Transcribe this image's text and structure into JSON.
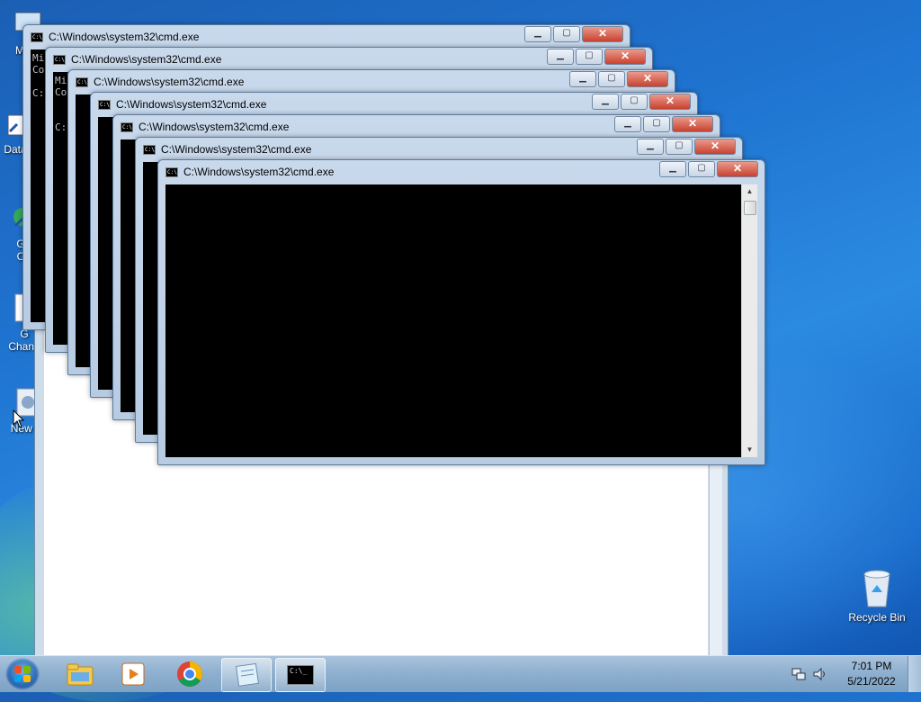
{
  "desktop": {
    "icons": [
      {
        "label": "My C",
        "icon": "computer-icon"
      },
      {
        "label": "Data",
        "icon": "shortcut-icon"
      },
      {
        "label": "G",
        "label2": "C",
        "icon": "shortcut-icon"
      },
      {
        "label": "G",
        "label2": "Chang",
        "icon": "document-icon"
      },
      {
        "label": "New T",
        "icon": "settings-icon"
      },
      {
        "label": "Recycle Bin",
        "icon": "recycle-bin-icon"
      }
    ]
  },
  "windows": [
    {
      "title": "C:\\Windows\\system32\\cmd.exe",
      "text": "Mi\nCo\n\nC:"
    },
    {
      "title": "C:\\Windows\\system32\\cmd.exe",
      "text": "Mi\nCo\n\n\nC:"
    },
    {
      "title": "C:\\Windows\\system32\\cmd.exe",
      "text": ""
    },
    {
      "title": "C:\\Windows\\system32\\cmd.exe",
      "text": ""
    },
    {
      "title": "C:\\Windows\\system32\\cmd.exe",
      "text": ""
    },
    {
      "title": "C:\\Windows\\system32\\cmd.exe",
      "text": ""
    },
    {
      "title": "C:\\Windows\\system32\\cmd.exe",
      "text": ""
    }
  ],
  "window_buttons": {
    "minimize": "▁",
    "maximize": "▢",
    "close": "✕"
  },
  "taskbar": {
    "items": [
      "windows-explorer",
      "media-player",
      "chrome",
      "notepad",
      "command-prompt"
    ],
    "clock_time": "7:01 PM",
    "clock_date": "5/21/2022",
    "cmd_icon_text": "C:\\_"
  }
}
